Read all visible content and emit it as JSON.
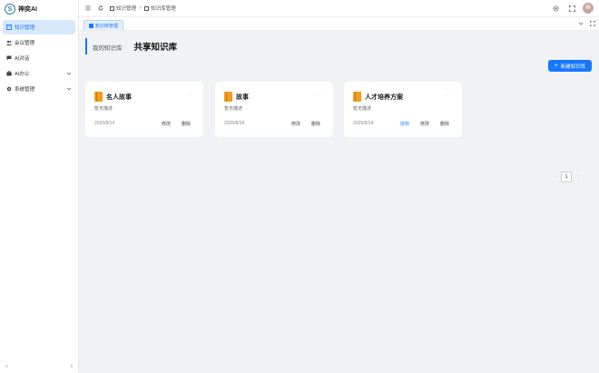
{
  "app": {
    "title": "神奕AI",
    "logo_letter": "S"
  },
  "sidebar": {
    "items": [
      {
        "label": "知识管理",
        "icon": "book-icon",
        "active": true
      },
      {
        "label": "会议管理",
        "icon": "users-icon"
      },
      {
        "label": "AI对话",
        "icon": "chat-icon"
      },
      {
        "label": "AI办公",
        "icon": "briefcase-icon",
        "expandable": true
      },
      {
        "label": "系统管理",
        "icon": "gear-icon",
        "expandable": true
      }
    ],
    "bottom_left": "«",
    "bottom_right": "⇧"
  },
  "header": {
    "breadcrumb": [
      "知识管理",
      "知识库管理"
    ],
    "breadcrumb_sep": ">"
  },
  "tabs": [
    {
      "label": "知识库管理",
      "active": true
    }
  ],
  "main": {
    "kb_tabs": [
      {
        "label": "我的知识库",
        "active": false
      },
      {
        "label": "共享知识库",
        "active": true
      }
    ],
    "new_button_label": "新建知识库",
    "new_button_plus": "+",
    "cards": [
      {
        "title": "名人故事",
        "desc": "暂无描述",
        "date": "2025/8/14",
        "more": "···",
        "actions": [
          "修改",
          "删除"
        ]
      },
      {
        "title": "故事",
        "desc": "暂无描述",
        "date": "2025/8/14",
        "more": "···",
        "actions": [
          "修改",
          "删除"
        ]
      },
      {
        "title": "人才培养方案",
        "desc": "暂无描述",
        "date": "2025/8/14",
        "more": "···",
        "actions": [
          "授权",
          "修改",
          "删除"
        ]
      }
    ],
    "pagination": {
      "prev": "‹",
      "current": "1",
      "next": "›"
    }
  },
  "colors": {
    "primary": "#1677ff",
    "book": "#f39c1f",
    "active_bg": "#d8e8fb"
  }
}
